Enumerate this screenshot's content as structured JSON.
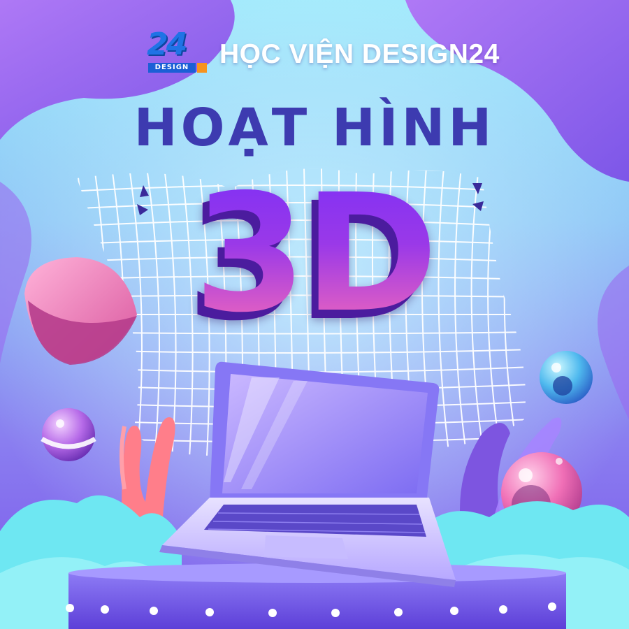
{
  "brand": {
    "logo_digits": "24",
    "logo_word": "DESIGN",
    "name": "HỌC VIỆN DESIGN24"
  },
  "title": {
    "line1": "HOẠT HÌNH",
    "big": "3D"
  },
  "colors": {
    "background_top": "#6fd8f5",
    "background_bottom": "#8a5cf0",
    "title_text": "#3d3bb0",
    "big_title_top": "#7b2ff7",
    "big_title_bottom": "#ff6fb3",
    "logo_blue": "#1f73e6",
    "logo_orange": "#f7931e"
  },
  "decor": [
    "wire-mesh",
    "laptop-illustration",
    "pink-hemisphere",
    "blue-orb",
    "purple-orb",
    "pink-orb",
    "coral-plant",
    "foliage",
    "stage-podium"
  ]
}
